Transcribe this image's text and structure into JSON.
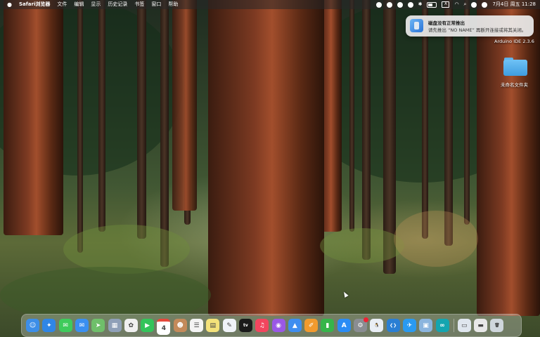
{
  "menubar": {
    "app_name": "Safari浏览器",
    "menus": [
      "文件",
      "编辑",
      "显示",
      "历史记录",
      "书签",
      "窗口",
      "帮助"
    ],
    "input_source": "A",
    "clock": "7月4日 周五  11:28"
  },
  "notification": {
    "title": "磁盘没有正常推出",
    "body": "请先推出 “NO NAME” 再断开连接或将其关闭。"
  },
  "desktop": {
    "window_label": "Arduino IDE 2.3.6",
    "folder_label": "未命名文件夹"
  },
  "dock": {
    "apps": [
      {
        "name": "Finder",
        "color": "#3c8ee8",
        "glyph": "☺"
      },
      {
        "name": "Safari",
        "color": "#2f86e6",
        "glyph": "✦"
      },
      {
        "name": "Messages",
        "color": "#3ecb5b",
        "glyph": "✉"
      },
      {
        "name": "Mail",
        "color": "#3a8ff0",
        "glyph": "✉"
      },
      {
        "name": "Maps",
        "color": "#6fbf6a",
        "glyph": "➤"
      },
      {
        "name": "Launchpad",
        "color": "#8fa0b8",
        "glyph": "▦"
      },
      {
        "name": "Photos",
        "color": "#f0f0f0",
        "glyph": "✿"
      },
      {
        "name": "FaceTime",
        "color": "#33c45a",
        "glyph": "▶"
      },
      {
        "name": "Calendar",
        "color": "#ffffff",
        "glyph": "4"
      },
      {
        "name": "Contacts",
        "color": "#c48a5a",
        "glyph": "☻"
      },
      {
        "name": "Reminders",
        "color": "#f4f4f4",
        "glyph": "☰"
      },
      {
        "name": "Notes",
        "color": "#f4e27a",
        "glyph": "▤"
      },
      {
        "name": "Freeform",
        "color": "#f0f3f8",
        "glyph": "✎"
      },
      {
        "name": "TV",
        "color": "#1a1a1a",
        "glyph": "tv"
      },
      {
        "name": "Music",
        "color": "#f2455e",
        "glyph": "♫"
      },
      {
        "name": "Podcasts",
        "color": "#9a58e6",
        "glyph": "◉"
      },
      {
        "name": "Keynote",
        "color": "#3f8ef0",
        "glyph": "▲"
      },
      {
        "name": "Pages",
        "color": "#f29a2e",
        "glyph": "✐"
      },
      {
        "name": "Numbers",
        "color": "#36b54a",
        "glyph": "▮"
      },
      {
        "name": "App Store",
        "color": "#2a8cf5",
        "glyph": "A"
      },
      {
        "name": "System Settings",
        "color": "#8a8d92",
        "glyph": "⚙"
      },
      {
        "name": "QQ",
        "color": "#e9eef5",
        "glyph": "🐧"
      },
      {
        "name": "VS Code",
        "color": "#2a7fd4",
        "glyph": "❮❯"
      },
      {
        "name": "TestFlight",
        "color": "#2a9af0",
        "glyph": "✈"
      },
      {
        "name": "Preview",
        "color": "#8bb5de",
        "glyph": "▣"
      },
      {
        "name": "Arduino IDE",
        "color": "#14a5b0",
        "glyph": "∞"
      }
    ],
    "others": [
      {
        "name": "Downloads",
        "color": "#dfe6ee",
        "glyph": "▭"
      },
      {
        "name": "Documents",
        "color": "#e8e8e8",
        "glyph": "▬"
      },
      {
        "name": "Trash",
        "color": "#cfd6dc",
        "glyph": "🗑"
      }
    ]
  }
}
